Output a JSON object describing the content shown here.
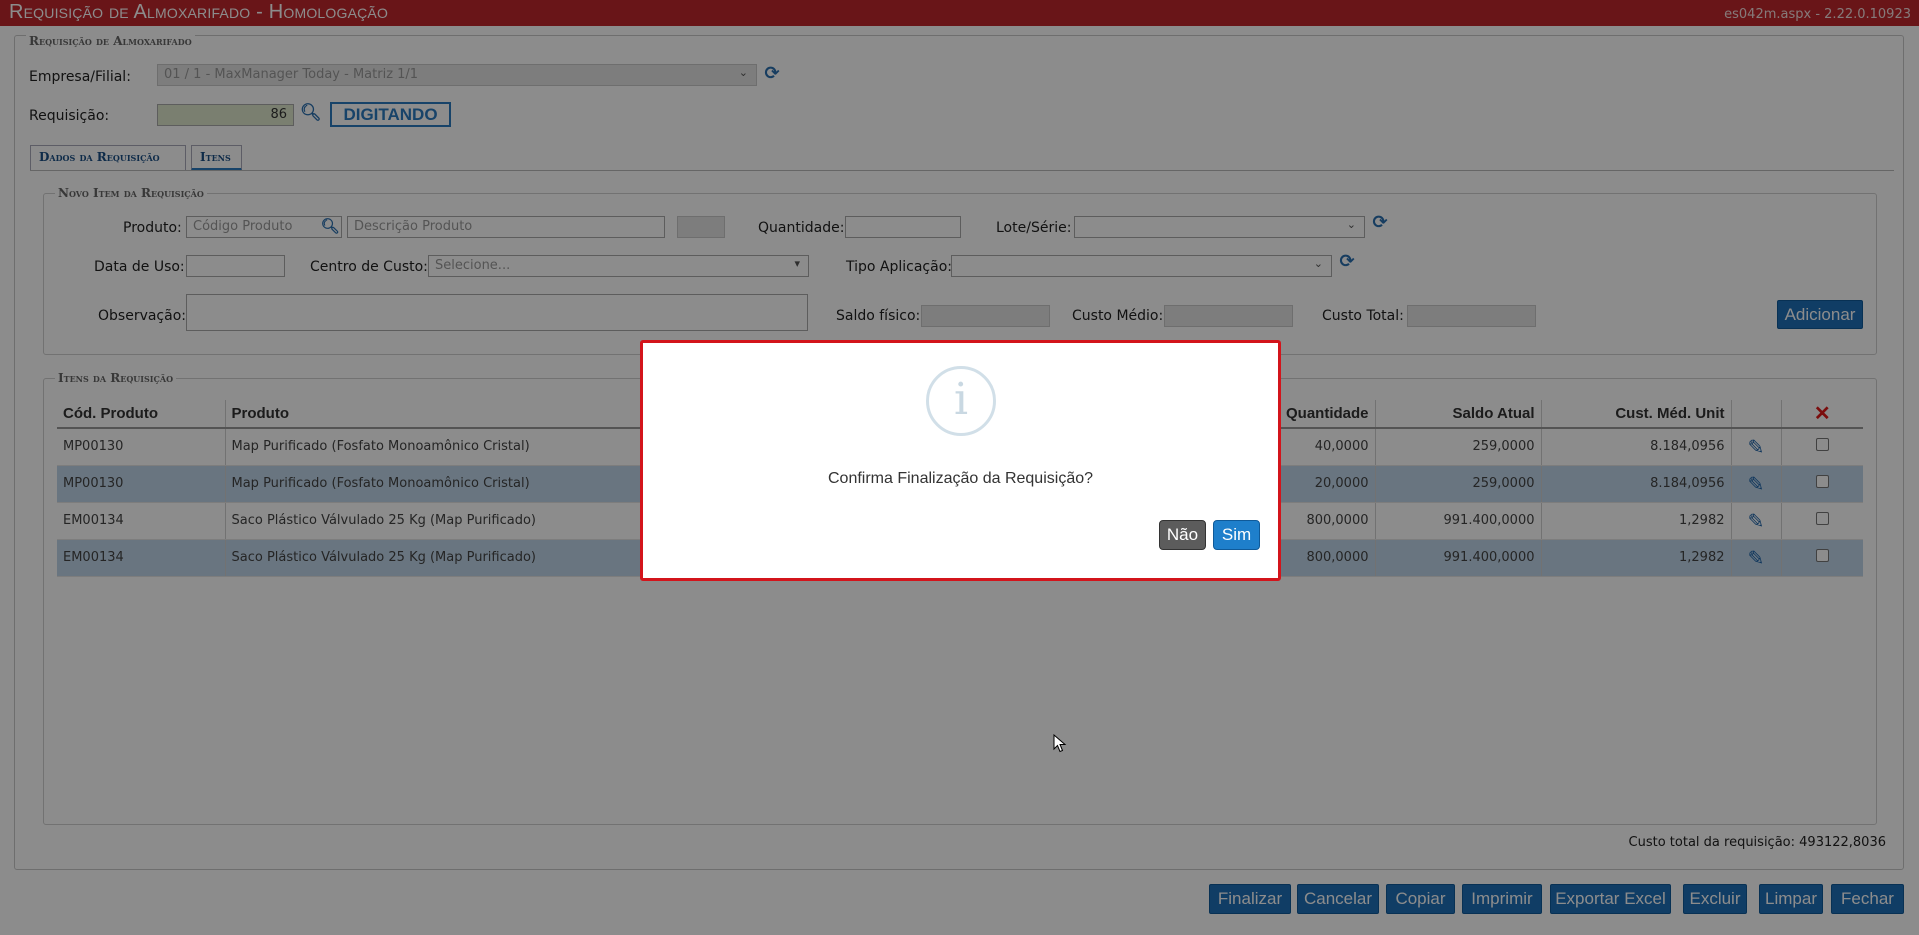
{
  "window": {
    "title": "Requisição de Almoxarifado  - Homologação",
    "version": "es042m.aspx - 2.22.0.10923"
  },
  "header": {
    "section_title": "Requisição de Almoxarifado",
    "empresa_label": "Empresa/Filial:",
    "empresa_value": "01 / 1 - MaxManager Today - Matriz 1/1",
    "requisicao_label": "Requisição:",
    "requisicao_value": "86",
    "status_badge": "DIGITANDO"
  },
  "tabs": [
    {
      "label": "Dados da Requisição"
    },
    {
      "label": "Itens"
    }
  ],
  "novo_item": {
    "legend": "Novo Item da Requisição",
    "produto_label": "Produto:",
    "codigo_placeholder": "Código Produto",
    "descricao_placeholder": "Descrição Produto",
    "quantidade_label": "Quantidade:",
    "lote_label": "Lote/Série:",
    "data_uso_label": "Data de Uso:",
    "centro_custo_label": "Centro de Custo:",
    "centro_custo_value": "Selecione...",
    "tipo_aplicacao_label": "Tipo Aplicação:",
    "observacao_label": "Observação:",
    "saldo_fisico_label": "Saldo físico:",
    "custo_medio_label": "Custo Médio:",
    "custo_total_label": "Custo Total:",
    "adicionar_label": "Adicionar"
  },
  "itens": {
    "legend": "Itens da Requisição",
    "columns": [
      "Cód. Produto",
      "Produto",
      "Quantidade",
      "Saldo Atual",
      "Cust. Méd. Unit"
    ],
    "rows": [
      {
        "codigo": "MP00130",
        "produto": "Map Purificado (Fosfato Monoamônico Cristal)",
        "quantidade": "40,0000",
        "saldo": "259,0000",
        "custo": "8.184,0956"
      },
      {
        "codigo": "MP00130",
        "produto": "Map Purificado (Fosfato Monoamônico Cristal)",
        "quantidade": "20,0000",
        "saldo": "259,0000",
        "custo": "8.184,0956"
      },
      {
        "codigo": "EM00134",
        "produto": "Saco Plástico Válvulado 25 Kg (Map Purificado)",
        "quantidade": "800,0000",
        "saldo": "991.400,0000",
        "custo": "1,2982"
      },
      {
        "codigo": "EM00134",
        "produto": "Saco Plástico Válvulado 25 Kg (Map Purificado)",
        "quantidade": "800,0000",
        "saldo": "991.400,0000",
        "custo": "1,2982"
      }
    ],
    "total_label": "Custo total da requisição:",
    "total_value": "493122,8036"
  },
  "footer_buttons": [
    "Finalizar",
    "Cancelar",
    "Copiar",
    "Imprimir",
    "Exportar Excel",
    "Excluir",
    "Limpar",
    "Fechar"
  ],
  "dialog": {
    "icon": "info-icon",
    "message": "Confirma Finalização da Requisição?",
    "no_label": "Não",
    "yes_label": "Sim",
    "border_color": "#d3141b"
  },
  "colors": {
    "title_bar": "#c0272d",
    "accent": "#1e6fb8",
    "row_alt": "#bfd6ea"
  }
}
